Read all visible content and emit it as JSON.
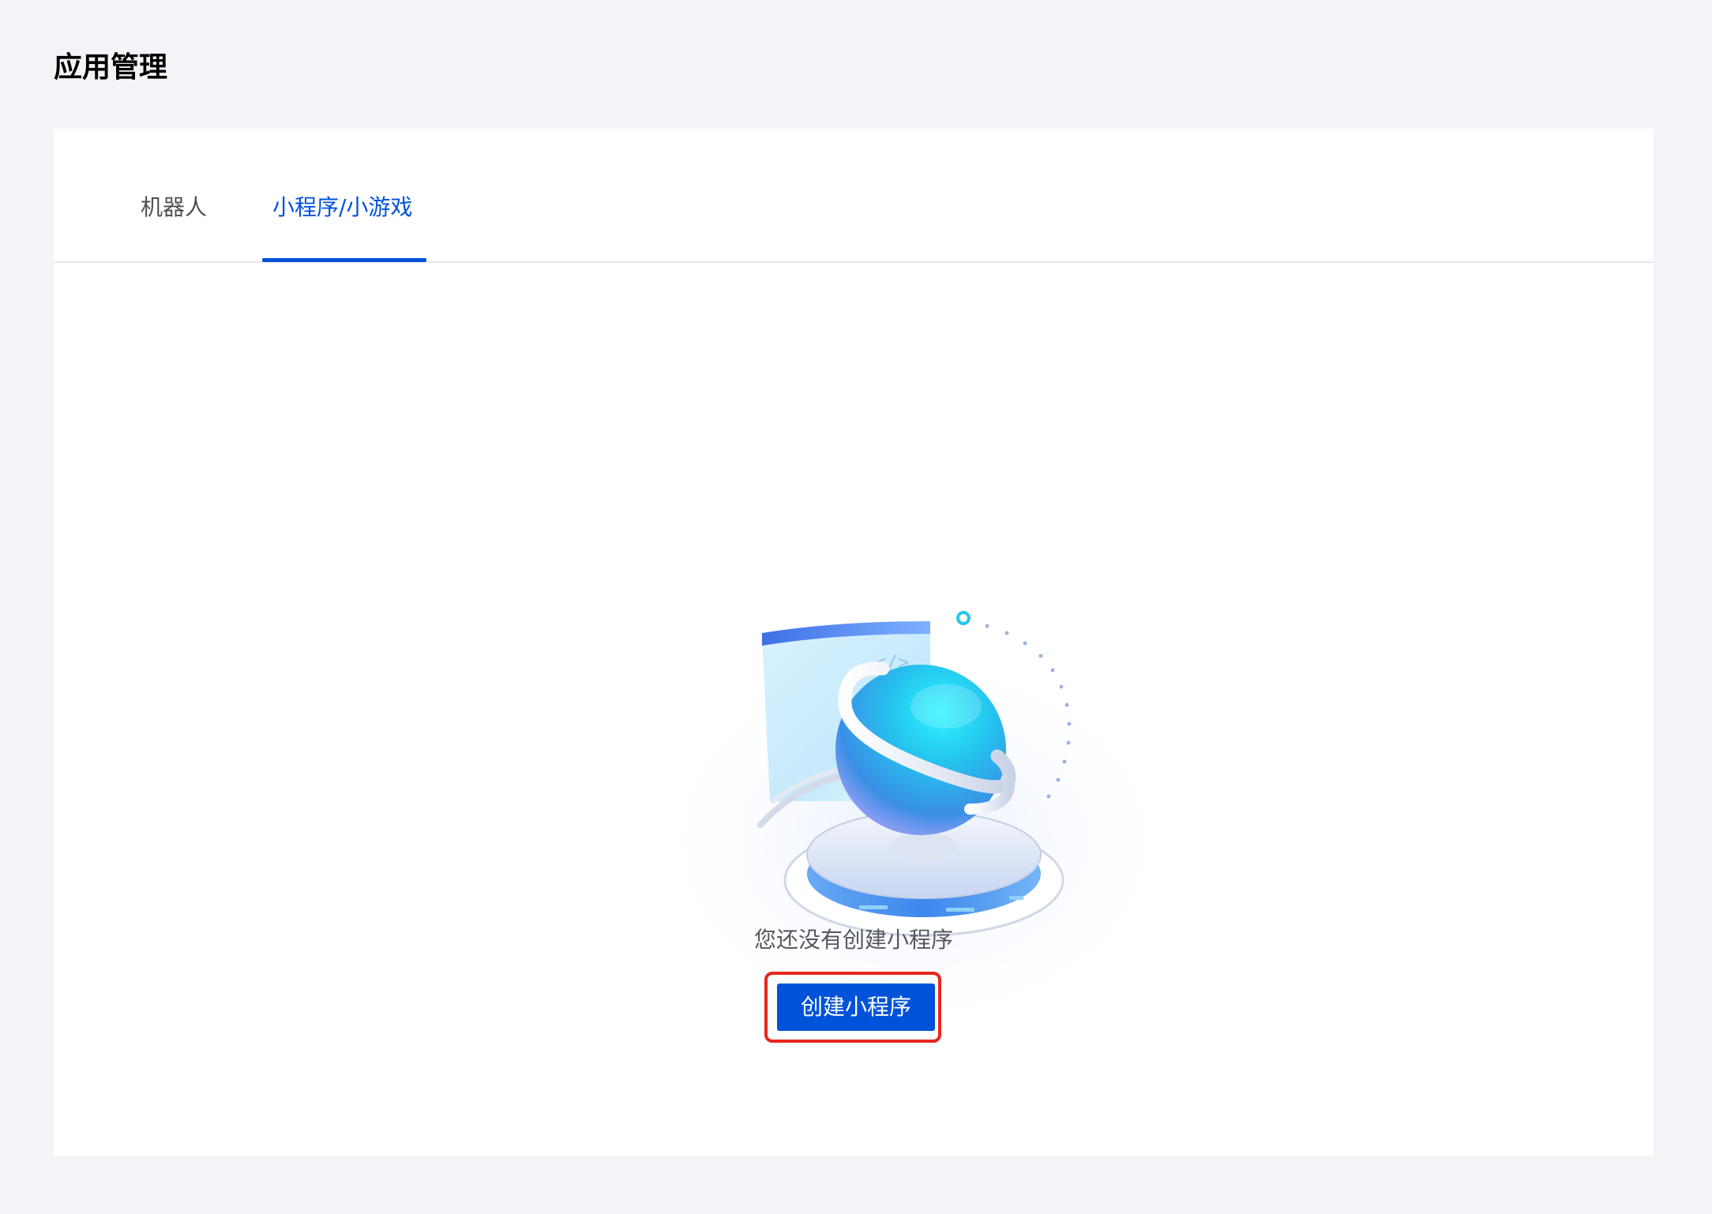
{
  "page": {
    "title": "应用管理"
  },
  "tabs": [
    {
      "label": "机器人",
      "active": false
    },
    {
      "label": "小程序/小游戏",
      "active": true
    }
  ],
  "empty_state": {
    "illustration_icon": "globe-code-illustration",
    "code_symbol": "</>",
    "message": "您还没有创建小程序",
    "button_label": "创建小程序"
  },
  "colors": {
    "accent": "#0052d9",
    "page_background": "#f3f4f7",
    "highlight_border": "#e8261d"
  }
}
